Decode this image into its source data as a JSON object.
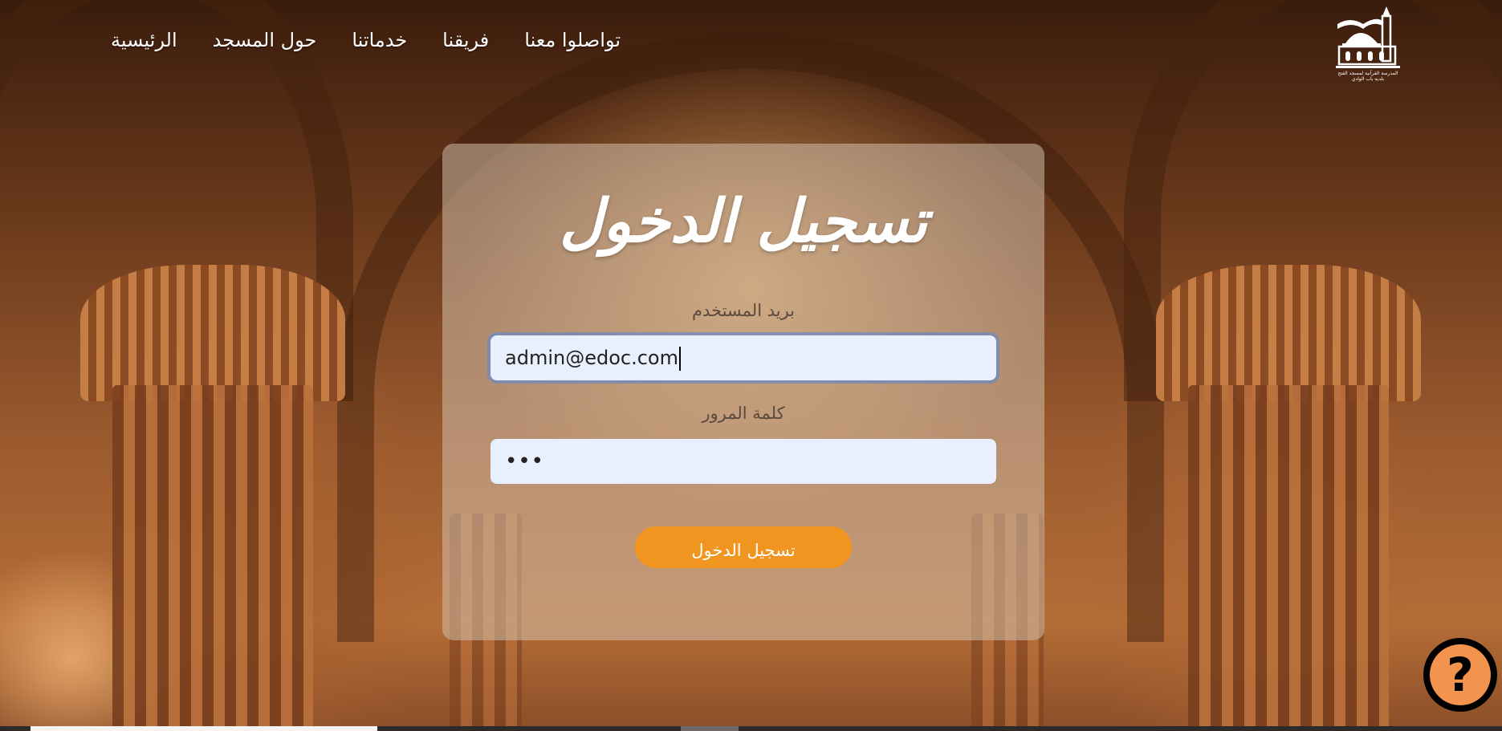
{
  "nav": {
    "items": [
      "الرئيسية",
      "حول المسجد",
      "خدماتنا",
      "فريقنا",
      "تواصلوا معنا"
    ]
  },
  "logo": {
    "text": "المدرسة القرآنية لمسجد الفتح بلدية باب الوادي"
  },
  "login": {
    "title": "تسجيل الدخول",
    "email_label": "بريد المستخدم",
    "email_value": "admin@edoc.com",
    "password_label": "كلمة المرور",
    "password_value": "•••",
    "submit_label": "تسجيل الدخول"
  },
  "help": {
    "symbol": "?",
    "icon": "question-icon"
  },
  "colors": {
    "button": "#f0951f",
    "input_bg": "#e8f0fe",
    "help_bg": "#f2934e"
  }
}
